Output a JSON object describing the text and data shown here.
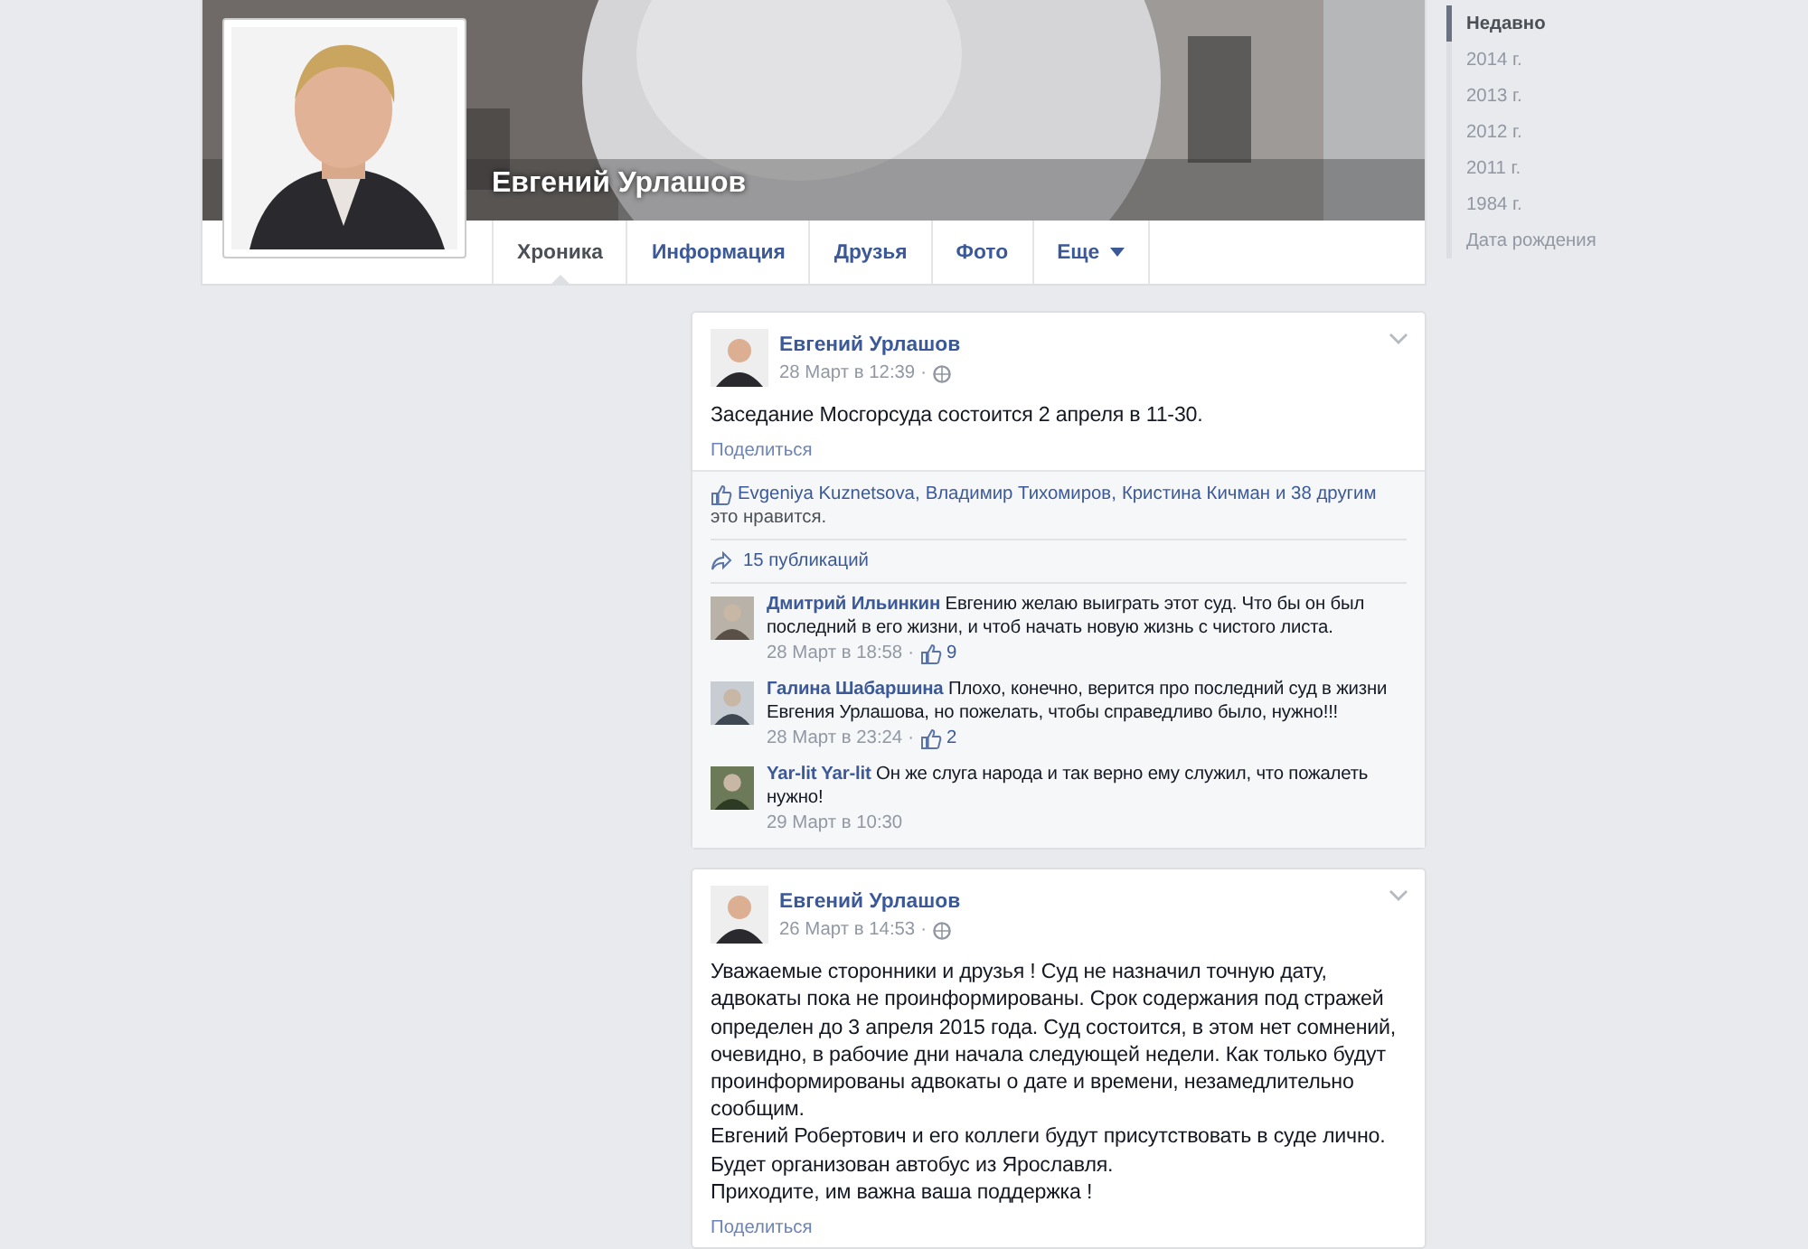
{
  "profile": {
    "name": "Евгений Урлашов",
    "tabs": [
      {
        "label": "Хроника",
        "selected": true
      },
      {
        "label": "Информация",
        "selected": false
      },
      {
        "label": "Друзья",
        "selected": false
      },
      {
        "label": "Фото",
        "selected": false
      },
      {
        "label": "Еще",
        "selected": false,
        "kind": "dropdown"
      }
    ]
  },
  "timeline_nav": [
    {
      "label": "Недавно",
      "selected": true
    },
    {
      "label": "2014 г.",
      "selected": false
    },
    {
      "label": "2013 г.",
      "selected": false
    },
    {
      "label": "2012 г.",
      "selected": false
    },
    {
      "label": "2011 г.",
      "selected": false
    },
    {
      "label": "1984 г.",
      "selected": false
    },
    {
      "label": "Дата рождения",
      "selected": false
    }
  ],
  "posts": [
    {
      "author": "Евгений Урлашов",
      "time": "28 Март в 12:39",
      "dot": "·",
      "paragraphs": [
        "Заседание Мосгорсуда состоится 2 апреля в 11-30."
      ],
      "share": "Поделиться",
      "likers": [
        "Evgeniya Kuznetsova,",
        "Владимир Тихомиров,",
        "Кристина Кичман",
        "и 38 другим"
      ],
      "likes_suffix": "это нравится.",
      "shares": "15 публикаций",
      "comments": [
        {
          "author": "Дмитрий Ильинкин",
          "text": "Евгению желаю выиграть этот суд. Что бы он был последний в его жизни, и чтоб начать новую жизнь с чистого листа.",
          "time": "28 Март в 18:58",
          "dot": "·",
          "likes": "9"
        },
        {
          "author": "Галина Шабаршина",
          "text": "Плохо, конечно, верится про последний суд в жизни Евгения Урлашова, но пожелать, чтобы справедливо было, нужно!!!",
          "time": "28 Март в 23:24",
          "dot": "·",
          "likes": "2"
        },
        {
          "author": "Yar-lit Yar-lit",
          "text": "Он же слуга народа и так верно ему служил, что пожалеть нужно!",
          "time": "29 Март в 10:30"
        }
      ]
    },
    {
      "author": "Евгений Урлашов",
      "time": "26 Март в 14:53",
      "dot": "·",
      "paragraphs": [
        "Уважаемые сторонники и друзья ! Суд не назначил точную дату, адвокаты пока не проинформированы. Срок содержания под стражей определен до 3 апреля 2015 года. Суд состоится, в этом нет сомнений, очевидно, в рабочие дни начала следующей недели. Как только будут проинформированы адвокаты о дате и времени, незамедлительно сообщим.",
        "Евгений Робертович и его коллеги будут присутствовать в суде лично.",
        "Будет организован автобус из Ярославля.",
        "Приходите, им важна ваша поддержка !"
      ],
      "share": "Поделиться"
    }
  ]
}
